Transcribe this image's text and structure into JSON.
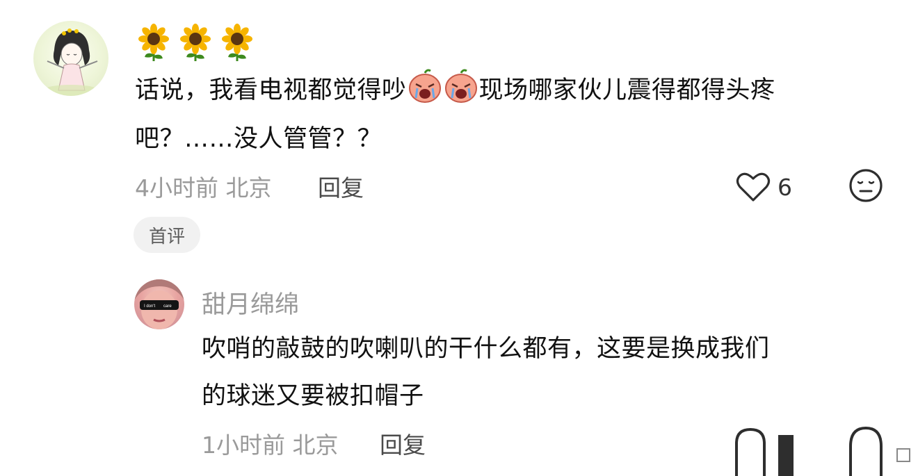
{
  "comment": {
    "emoji_line": "🌻🌻🌻",
    "text_line1_part1": "话说，我看电视都觉得吵",
    "text_line1_part2": "现场哪家伙儿震得都得头疼",
    "text_line2": "吧？……没人管管？？",
    "inline_emoji": "crying-face-sticker",
    "time": "4小时前",
    "location": "北京",
    "reply_label": "回复",
    "like_count": "6",
    "badge": "首评"
  },
  "reply": {
    "username": "甜月绵绵",
    "text_line1": "吹哨的敲鼓的吹喇叭的干什么都有，这要是换成我们",
    "text_line2": "的球迷又要被扣帽子",
    "time": "1小时前",
    "location": "北京",
    "reply_label": "回复",
    "avatar_caption_left": "I don't",
    "avatar_caption_right": "care"
  },
  "colors": {
    "meta_gray": "#9a9a9a",
    "badge_bg": "#f1f1f1",
    "sunflower_petal": "#f6b400",
    "sunflower_center": "#5a3512",
    "leaf_green": "#3d8a1e"
  }
}
